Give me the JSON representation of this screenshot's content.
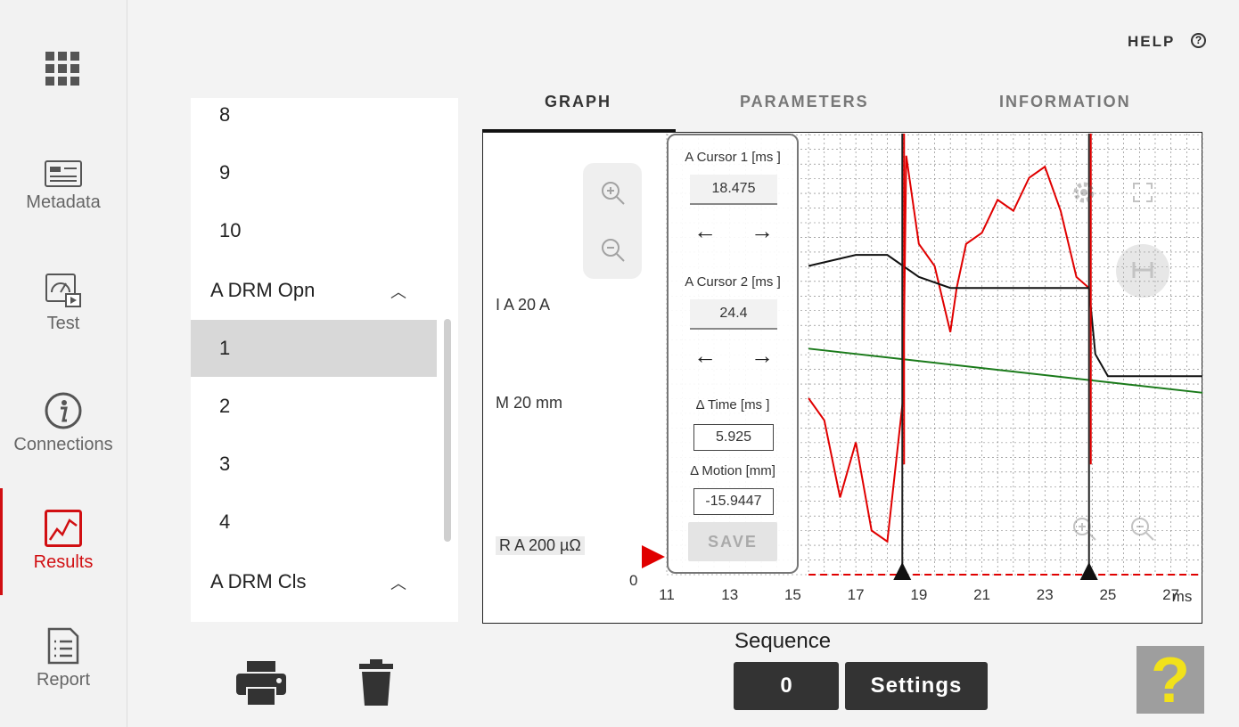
{
  "nav": {
    "items": [
      {
        "label": "Metadata"
      },
      {
        "label": "Test"
      },
      {
        "label": "Connections"
      },
      {
        "label": "Results"
      },
      {
        "label": "Report"
      }
    ],
    "active": "Results",
    "accent": "#d10f12"
  },
  "list": {
    "items": [
      {
        "label": "8"
      },
      {
        "label": "9"
      },
      {
        "label": "10"
      },
      {
        "label": "A DRM Opn"
      },
      {
        "label": "1"
      },
      {
        "label": "2"
      },
      {
        "label": "3"
      },
      {
        "label": "4"
      },
      {
        "label": "A DRM Cls"
      }
    ],
    "selected": "1"
  },
  "header": {
    "help_label": "HELP",
    "help_icon": "question-circle-icon"
  },
  "tabs": [
    {
      "label": "GRAPH"
    },
    {
      "label": "PARAMETERS"
    },
    {
      "label": "INFORMATION"
    }
  ],
  "graph": {
    "channels": [
      {
        "label": "I A  20 A"
      },
      {
        "label": "M   20 mm"
      },
      {
        "label": "R A  200 µΩ"
      }
    ],
    "zero_label": "0",
    "cursor_panel": {
      "cursor1_label": "A Cursor 1 [ms ]",
      "cursor1_value": "18.475",
      "cursor2_label": "A Cursor 2 [ms ]",
      "cursor2_value": "24.4",
      "dtime_label": "Δ Time [ms ]",
      "dtime_value": "5.925",
      "dmotion_label": "Δ Motion [mm]",
      "dmotion_value": "-15.9447",
      "save_label": "SAVE"
    }
  },
  "chart_data": {
    "type": "line",
    "x_ticks": [
      "11",
      "13",
      "15",
      "17",
      "19",
      "21",
      "23",
      "25",
      "27"
    ],
    "x_unit": "ms",
    "xlim": [
      11,
      28
    ],
    "cursors": [
      18.475,
      24.4
    ],
    "series": [
      {
        "color": "#e00000",
        "x": [
          15.5,
          16,
          16.5,
          17,
          17.5,
          18,
          18.5,
          18.6,
          19,
          19.5,
          20,
          20.2,
          20.5,
          21,
          21.5,
          22,
          22.5,
          23,
          23.5,
          24,
          24.4
        ],
        "y": [
          16,
          14,
          7,
          12,
          4,
          3,
          16,
          38,
          30,
          28,
          22,
          26,
          30,
          31,
          34,
          33,
          36,
          37,
          33,
          27,
          26
        ]
      },
      {
        "color": "#111111",
        "x": [
          15.5,
          17,
          18,
          18.5,
          19,
          20,
          21,
          22,
          23,
          24,
          24.4,
          24.6,
          25,
          26,
          27,
          28
        ],
        "y": [
          28,
          29,
          29,
          28,
          27,
          26,
          26,
          26,
          26,
          26,
          26,
          20,
          18,
          18,
          18,
          18
        ]
      },
      {
        "color": "#1a7a1a",
        "x": [
          15.5,
          28
        ],
        "y": [
          20.5,
          16.5
        ]
      },
      {
        "color": "#e00000",
        "x": [
          15.5,
          28
        ],
        "y": [
          0,
          0
        ]
      }
    ],
    "grid": true
  },
  "footer": {
    "sequence_label": "Sequence",
    "sequence_value": "0",
    "settings_label": "Settings",
    "help_glyph": "?"
  }
}
